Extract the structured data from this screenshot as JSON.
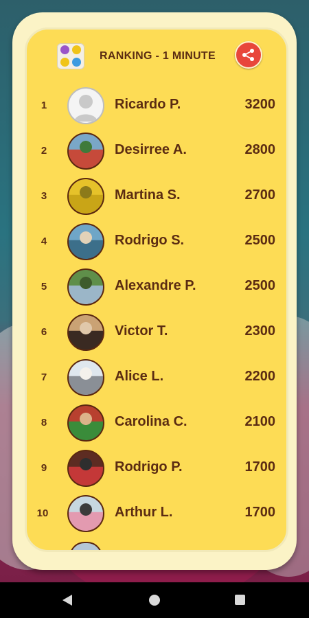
{
  "header": {
    "title": "RANKING - 1 MINUTE",
    "game_icon": "gems-game-icon",
    "share_icon": "share-icon"
  },
  "colors": {
    "card_fill": "#fddc55",
    "card_border": "#fbf3c6",
    "text": "#5b2c12",
    "share_button": "#e8463b"
  },
  "ranking": [
    {
      "rank": "1",
      "name": "Ricardo P.",
      "score": "3200",
      "avatar": "placeholder"
    },
    {
      "rank": "2",
      "name": "Desirree A.",
      "score": "2800",
      "avatar": "photo"
    },
    {
      "rank": "3",
      "name": "Martina S.",
      "score": "2700",
      "avatar": "photo"
    },
    {
      "rank": "4",
      "name": "Rodrigo S.",
      "score": "2500",
      "avatar": "photo"
    },
    {
      "rank": "5",
      "name": "Alexandre P.",
      "score": "2500",
      "avatar": "photo"
    },
    {
      "rank": "6",
      "name": "Victor T.",
      "score": "2300",
      "avatar": "photo"
    },
    {
      "rank": "7",
      "name": "Alice L.",
      "score": "2200",
      "avatar": "photo"
    },
    {
      "rank": "8",
      "name": "Carolina C.",
      "score": "2100",
      "avatar": "photo"
    },
    {
      "rank": "9",
      "name": "Rodrigo P.",
      "score": "1700",
      "avatar": "photo"
    },
    {
      "rank": "10",
      "name": "Arthur L.",
      "score": "1700",
      "avatar": "photo"
    }
  ],
  "navbar": {
    "back_icon": "back-triangle-icon",
    "home_icon": "home-circle-icon",
    "recents_icon": "recents-square-icon"
  }
}
